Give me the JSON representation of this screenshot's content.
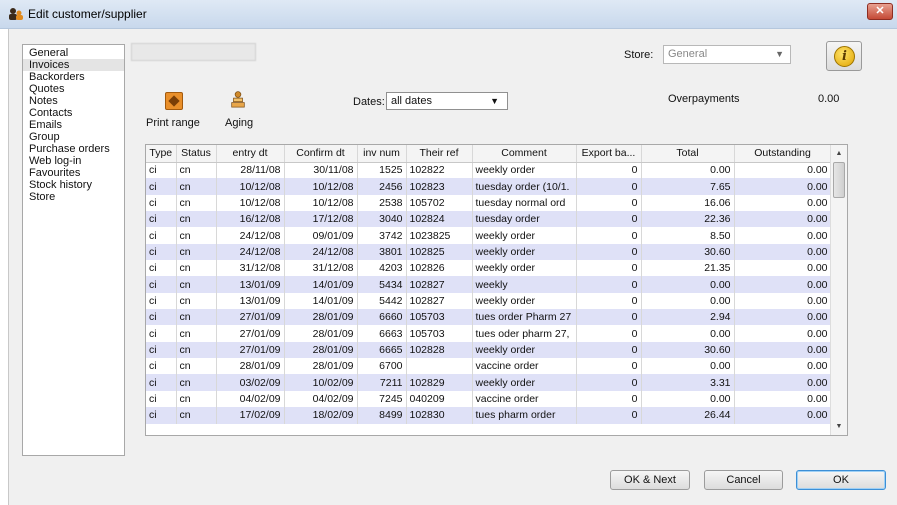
{
  "window": {
    "title": "Edit customer/supplier"
  },
  "sidebar": {
    "items": [
      {
        "label": "General",
        "selected": false
      },
      {
        "label": "Invoices",
        "selected": true
      },
      {
        "label": "Backorders",
        "selected": false
      },
      {
        "label": "Quotes",
        "selected": false
      },
      {
        "label": "Notes",
        "selected": false
      },
      {
        "label": "Contacts",
        "selected": false
      },
      {
        "label": "Emails",
        "selected": false
      },
      {
        "label": "Group",
        "selected": false
      },
      {
        "label": "Purchase orders",
        "selected": false
      },
      {
        "label": "Web log-in",
        "selected": false
      },
      {
        "label": "Favourites",
        "selected": false
      },
      {
        "label": "Stock history",
        "selected": false
      },
      {
        "label": "Store",
        "selected": false
      }
    ]
  },
  "header": {
    "store_label": "Store:",
    "store_value": "General"
  },
  "toolbar": {
    "print_range_label": "Print range",
    "aging_label": "Aging",
    "dates_label": "Dates:",
    "dates_value": "all dates",
    "overpayments_label": "Overpayments",
    "overpayments_value": "0.00"
  },
  "table": {
    "columns": [
      "Type",
      "Status",
      "entry dt",
      "Confirm dt",
      "inv num",
      "Their ref",
      "Comment",
      "Export ba...",
      "Total",
      "Outstanding"
    ],
    "rows": [
      [
        "ci",
        "cn",
        "28/11/08",
        "30/11/08",
        "1525",
        "102822",
        "weekly order",
        "0",
        "0.00",
        "0.00"
      ],
      [
        "ci",
        "cn",
        "10/12/08",
        "10/12/08",
        "2456",
        "102823",
        "tuesday order (10/1.",
        "0",
        "7.65",
        "0.00"
      ],
      [
        "ci",
        "cn",
        "10/12/08",
        "10/12/08",
        "2538",
        "105702",
        "tuesday normal ord",
        "0",
        "16.06",
        "0.00"
      ],
      [
        "ci",
        "cn",
        "16/12/08",
        "17/12/08",
        "3040",
        "102824",
        "tuesday order",
        "0",
        "22.36",
        "0.00"
      ],
      [
        "ci",
        "cn",
        "24/12/08",
        "09/01/09",
        "3742",
        "1023825",
        "weekly order",
        "0",
        "8.50",
        "0.00"
      ],
      [
        "ci",
        "cn",
        "24/12/08",
        "24/12/08",
        "3801",
        "102825",
        "weekly order",
        "0",
        "30.60",
        "0.00"
      ],
      [
        "ci",
        "cn",
        "31/12/08",
        "31/12/08",
        "4203",
        "102826",
        "weekly order",
        "0",
        "21.35",
        "0.00"
      ],
      [
        "ci",
        "cn",
        "13/01/09",
        "14/01/09",
        "5434",
        "102827",
        "weekly",
        "0",
        "0.00",
        "0.00"
      ],
      [
        "ci",
        "cn",
        "13/01/09",
        "14/01/09",
        "5442",
        "102827",
        "weekly order",
        "0",
        "0.00",
        "0.00"
      ],
      [
        "ci",
        "cn",
        "27/01/09",
        "28/01/09",
        "6660",
        "105703",
        "tues order Pharm 27",
        "0",
        "2.94",
        "0.00"
      ],
      [
        "ci",
        "cn",
        "27/01/09",
        "28/01/09",
        "6663",
        "105703",
        "tues oder pharm 27,",
        "0",
        "0.00",
        "0.00"
      ],
      [
        "ci",
        "cn",
        "27/01/09",
        "28/01/09",
        "6665",
        "102828",
        "weekly order",
        "0",
        "30.60",
        "0.00"
      ],
      [
        "ci",
        "cn",
        "28/01/09",
        "28/01/09",
        "6700",
        "",
        "vaccine order",
        "0",
        "0.00",
        "0.00"
      ],
      [
        "ci",
        "cn",
        "03/02/09",
        "10/02/09",
        "7211",
        "102829",
        "weekly order",
        "0",
        "3.31",
        "0.00"
      ],
      [
        "ci",
        "cn",
        "04/02/09",
        "04/02/09",
        "7245",
        "040209",
        "vaccine order",
        "0",
        "0.00",
        "0.00"
      ],
      [
        "ci",
        "cn",
        "17/02/09",
        "18/02/09",
        "8499",
        "102830",
        "tues pharm order",
        "0",
        "26.44",
        "0.00"
      ]
    ]
  },
  "footer": {
    "ok_next_label": "OK & Next",
    "cancel_label": "Cancel",
    "ok_label": "OK"
  },
  "colors": {
    "alt_row": "#dfe1f7",
    "default_button_border": "#3c8fd6"
  }
}
